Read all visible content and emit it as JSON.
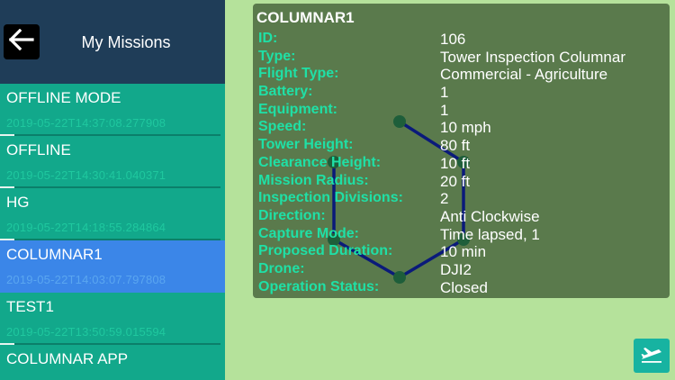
{
  "sidebar": {
    "title": "My Missions",
    "missions": [
      {
        "name": "OFFLINE MODE",
        "date": "2019-05-22T14:37:08.277908",
        "selected": false
      },
      {
        "name": "OFFLINE",
        "date": "2019-05-22T14:30:41.040371",
        "selected": false
      },
      {
        "name": "HG",
        "date": "2019-05-22T14:18:55.284864",
        "selected": false
      },
      {
        "name": "COLUMNAR1",
        "date": "2019-05-22T14:03:07.797808",
        "selected": true
      },
      {
        "name": "TEST1",
        "date": "2019-05-22T13:50:59.015594",
        "selected": false
      },
      {
        "name": "COLUMNAR APP",
        "date": "",
        "selected": false
      }
    ]
  },
  "details": {
    "title": "COLUMNAR1",
    "rows": [
      {
        "label": "ID:",
        "value": "106"
      },
      {
        "label": "Type:",
        "value": "Tower Inspection Columnar"
      },
      {
        "label": "Flight Type:",
        "value": "Commercial - Agriculture"
      },
      {
        "label": "Battery:",
        "value": "1"
      },
      {
        "label": "Equipment:",
        "value": "1"
      },
      {
        "label": "Speed:",
        "value": "10 mph"
      },
      {
        "label": "Tower Height:",
        "value": "80 ft"
      },
      {
        "label": "Clearance Height:",
        "value": "10 ft"
      },
      {
        "label": "Mission Radius:",
        "value": "20 ft"
      },
      {
        "label": "Inspection Divisions:",
        "value": "2"
      },
      {
        "label": "Direction:",
        "value": "Anti Clockwise"
      },
      {
        "label": "Capture Mode:",
        "value": "Time lapsed, 1"
      },
      {
        "label": "Proposed Duration:",
        "value": "10 min"
      },
      {
        "label": "Drone:",
        "value": "DJI2"
      },
      {
        "label": "Operation Status:",
        "value": "Closed"
      }
    ]
  },
  "icons": {
    "back": "arrow-left-icon",
    "fly": "airplane-icon"
  },
  "colors": {
    "accent_label": "#1fe0a6",
    "selected_item": "#3b86e8",
    "path_line": "#0a1a7a",
    "waypoint": "#1e5e3a"
  }
}
